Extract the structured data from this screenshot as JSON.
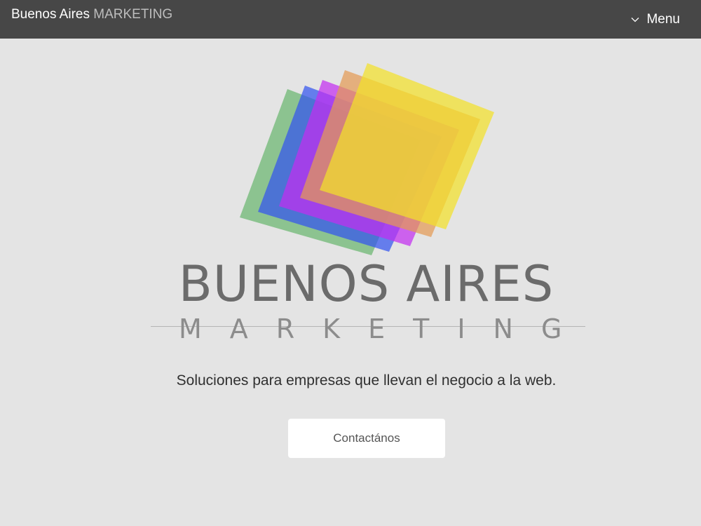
{
  "navbar": {
    "brand_main": "Buenos Aires",
    "brand_light": "MARKETING",
    "menu_label": "Menu"
  },
  "hero": {
    "logo_word": "BUENOS AIRES",
    "logo_sub": "MARKETING",
    "tagline": "Soluciones para empresas que llevan el negocio a la web.",
    "cta_label": "Contactános"
  },
  "colors": {
    "navbar": "#474747",
    "background": "#e4e4e4",
    "square_green": "#6ab56f",
    "square_blue": "#3355ee",
    "square_violet": "#c22ef0",
    "square_orange": "#e39a55",
    "square_yellow": "#f2e02a"
  },
  "icons": {
    "menu": "chevron-down-icon"
  }
}
